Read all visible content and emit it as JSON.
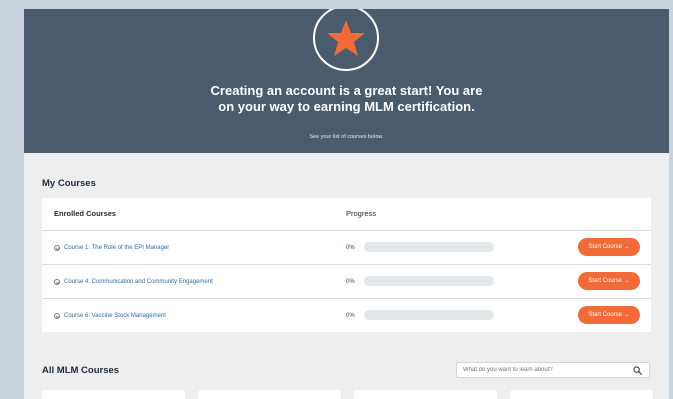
{
  "hero": {
    "title_line1": "Creating an account is a great start! You are",
    "title_line2": "on your way to earning MLM certification.",
    "subtitle": "See your list of courses below.",
    "badge_icon": "star-icon"
  },
  "my_courses": {
    "title": "My Courses",
    "headers": {
      "enrolled": "Enrolled Courses",
      "progress": "Progress"
    },
    "rows": [
      {
        "course": "Course 1: The Role of the EPI Manager",
        "progress_text": "0%",
        "progress": 0,
        "button": "Start Course →"
      },
      {
        "course": "Course 4: Communication and Community Engagement",
        "progress_text": "0%",
        "progress": 0,
        "button": "Start Course →"
      },
      {
        "course": "Course 6: Vaccine Stock Management",
        "progress_text": "0%",
        "progress": 0,
        "button": "Start Course →"
      }
    ]
  },
  "all_courses": {
    "title": "All MLM Courses",
    "search_placeholder": "What do you want to learn about?"
  },
  "colors": {
    "hero_bg": "#4a5b6e",
    "accent": "#f26a36",
    "link": "#2b6ea8"
  }
}
